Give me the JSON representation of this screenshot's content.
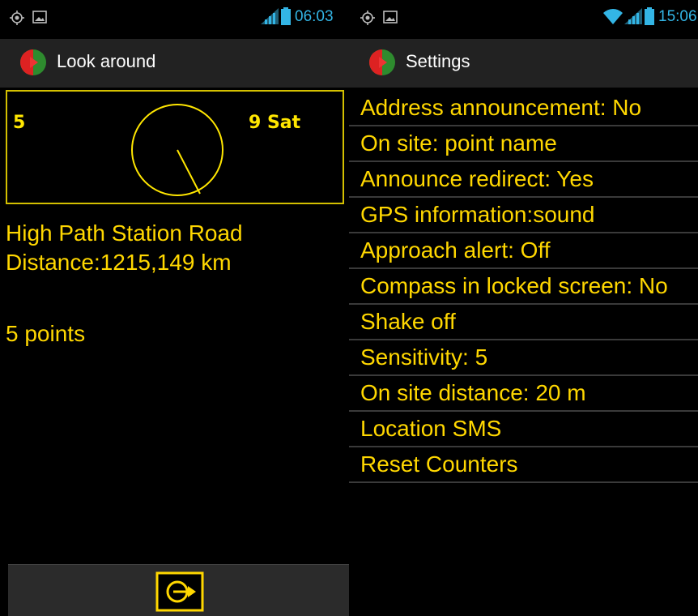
{
  "left_screen": {
    "status": {
      "time": "06:03"
    },
    "title": "Look around",
    "compass": {
      "left_value": "5",
      "satellites": "9 Sat"
    },
    "info": {
      "place": "High Path Station Road",
      "distance": "Distance:1215,149 km",
      "points": "5 points"
    },
    "bottom_button": "go-icon"
  },
  "right_screen": {
    "status": {
      "time": "15:06"
    },
    "title": "Settings",
    "items": [
      "Address announcement: No",
      "On site: point name",
      "Announce redirect: Yes",
      "GPS information:sound",
      "Approach alert: Off",
      "Compass in locked screen: No",
      "Shake off",
      "Sensitivity: 5",
      "On site distance: 20 m",
      "Location SMS",
      "Reset Counters"
    ]
  },
  "colors": {
    "accent_yellow": "#ffd700",
    "status_blue": "#33b5e5",
    "panel_border": "#d4c000"
  }
}
